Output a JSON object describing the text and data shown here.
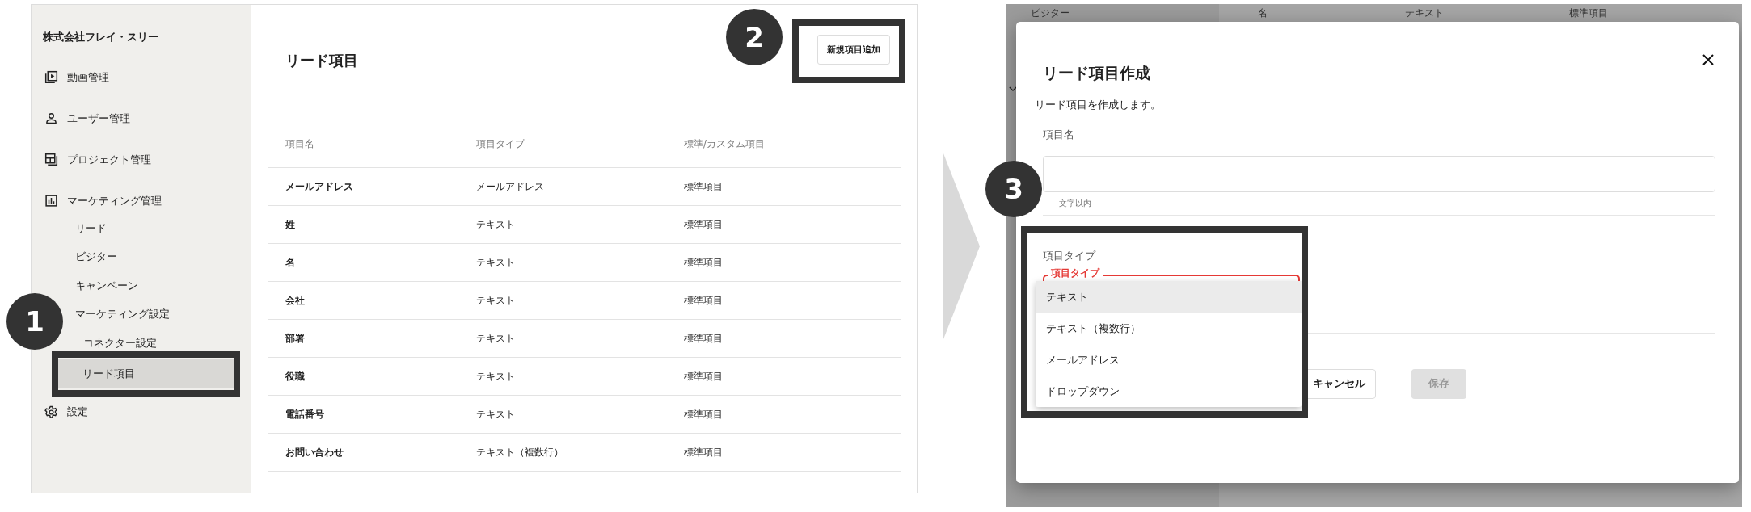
{
  "left_screen": {
    "sidebar": {
      "company": "株式会社フレイ・スリー",
      "items": [
        {
          "label": "動画管理",
          "selected": false
        },
        {
          "label": "ユーザー管理",
          "selected": false
        },
        {
          "label": "プロジェクト管理",
          "selected": false
        },
        {
          "label": "マーケティング管理",
          "selected": false,
          "children": [
            {
              "label": "リード",
              "selected": false
            },
            {
              "label": "ビジター",
              "selected": false
            },
            {
              "label": "キャンペーン",
              "selected": false
            },
            {
              "label": "マーケティング設定",
              "selected": false,
              "children": [
                {
                  "label": "コネクター設定",
                  "selected": false
                },
                {
                  "label": "リード項目",
                  "selected": true
                }
              ]
            }
          ]
        },
        {
          "label": "設定",
          "selected": false
        }
      ]
    },
    "page_title": "リード項目",
    "add_button": "新規項目追加",
    "table": {
      "columns": [
        "項目名",
        "項目タイプ",
        "標準/カスタム項目"
      ],
      "rows": [
        [
          "メールアドレス",
          "メールアドレス",
          "標準項目"
        ],
        [
          "姓",
          "テキスト",
          "標準項目"
        ],
        [
          "名",
          "テキスト",
          "標準項目"
        ],
        [
          "会社",
          "テキスト",
          "標準項目"
        ],
        [
          "部署",
          "テキスト",
          "標準項目"
        ],
        [
          "役職",
          "テキスト",
          "標準項目"
        ],
        [
          "電話番号",
          "テキスト",
          "標準項目"
        ],
        [
          "お問い合わせ",
          "テキスト（複数行）",
          "標準項目"
        ]
      ]
    }
  },
  "right_screen": {
    "background_texts": [
      "ビジター",
      "名",
      "テキスト",
      "標準項目"
    ],
    "dialog": {
      "title": "リード項目作成",
      "subtitle": "リード項目を作成します。",
      "name_label": "項目名",
      "name_hint": "文字以内",
      "type_label": "項目タイプ",
      "type_select": {
        "label": "項目タイプ",
        "focused": true,
        "options": [
          {
            "label": "テキスト",
            "selected": true
          },
          {
            "label": "テキスト（複数行）",
            "selected": false
          },
          {
            "label": "メールアドレス",
            "selected": false
          },
          {
            "label": "ドロップダウン",
            "selected": false
          }
        ]
      },
      "cancel_button": "キャンセル",
      "save_button": {
        "label": "保存",
        "disabled": true
      }
    }
  },
  "annotations": [
    {
      "number": "1"
    },
    {
      "number": "2"
    },
    {
      "number": "3"
    }
  ]
}
